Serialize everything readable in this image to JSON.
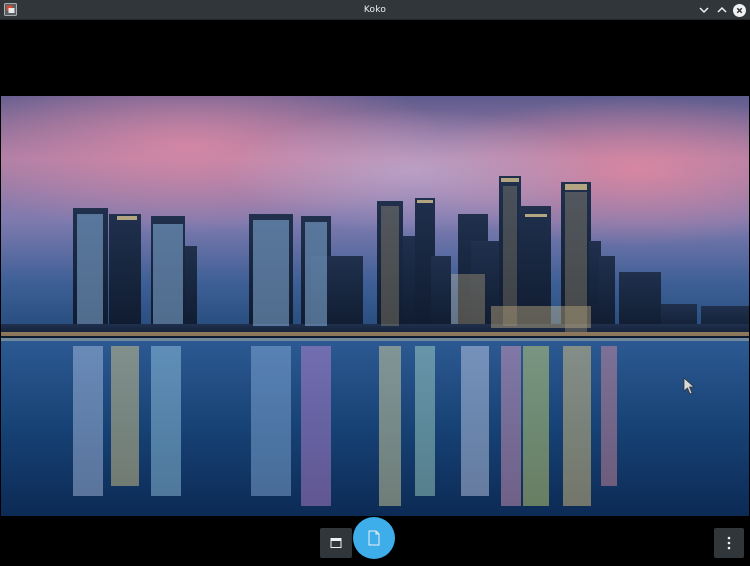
{
  "window": {
    "title": "Koko",
    "app_icon": "koko-app-icon",
    "controls": [
      "chevron-down-icon",
      "chevron-up-icon",
      "close-icon"
    ]
  },
  "viewer": {
    "image_icon": "cityscape-photo",
    "toolbar": {
      "view_button_icon": "window-icon",
      "primary_action_icon": "document-icon",
      "menu_button_icon": "kebab-menu-icon"
    }
  },
  "colors": {
    "titlebar": "#31363b",
    "titlebar_text": "#eff0f1",
    "accent": "#3daee9",
    "background": "#000000"
  }
}
